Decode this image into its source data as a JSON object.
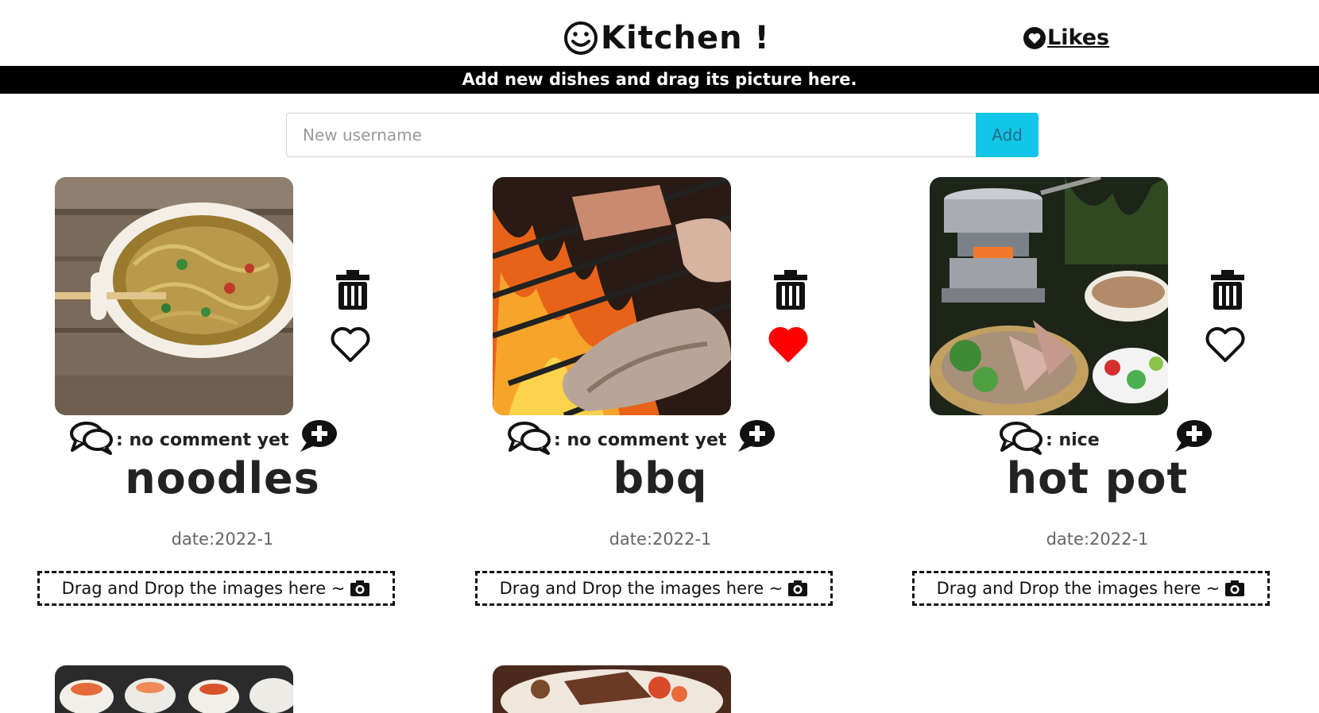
{
  "header": {
    "brand_title": "Kitchen !",
    "brand_icon": "smiley-icon",
    "likes_label": "Likes",
    "likes_icon": "heart-icon"
  },
  "banner": {
    "text": "Add new dishes and drag its picture here."
  },
  "search": {
    "placeholder": "New username",
    "value": "",
    "add_label": "Add"
  },
  "colors": {
    "accent": "#13c5e8",
    "liked": "#ff0000",
    "banner_bg": "#000000"
  },
  "cards": [
    {
      "name": "noodles",
      "date": "date:2022-1",
      "comment_prefix": ": ",
      "comment": "no comment yet",
      "liked": false,
      "drop_label": "Drag and Drop the images here ~",
      "drop_icon": "camera-icon"
    },
    {
      "name": "bbq",
      "date": "date:2022-1",
      "comment_prefix": ": ",
      "comment": "no comment yet",
      "liked": true,
      "drop_label": "Drag and Drop the images here ~",
      "drop_icon": "camera-icon"
    },
    {
      "name": "hot pot",
      "date": "date:2022-1",
      "comment_prefix": ": ",
      "comment": "nice",
      "liked": false,
      "drop_label": "Drag and Drop the images here ~",
      "drop_icon": "camera-icon"
    }
  ],
  "partial_cards": [
    "sushi",
    "steak"
  ]
}
